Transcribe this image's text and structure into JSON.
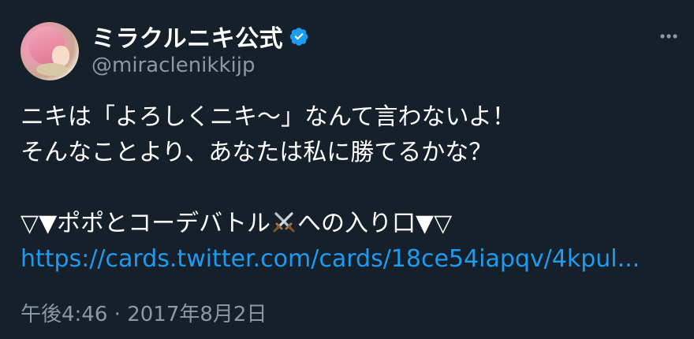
{
  "user": {
    "display_name": "ミラクルニキ公式",
    "handle": "@miraclenikkijp",
    "verified": true
  },
  "tweet": {
    "line1": "ニキは「よろしくニキ〜」なんて言わないよ！",
    "line2": "そんなことより、あなたは私に勝てるかな？",
    "line4_before": "▽▼ポポとコーデバトル",
    "line4_icon": "crossed-swords-emoji",
    "line4_after": "への入り口▼▽",
    "link": "https://cards.twitter.com/cards/18ce54iapqv/4kpul...",
    "time": "午後4:46",
    "separator": "·",
    "date": "2017年8月2日"
  },
  "icons": {
    "verified": "verified-badge-icon",
    "more": "more-options-icon"
  },
  "colors": {
    "background": "#15202b",
    "text": "#ffffff",
    "secondary": "#8b98a5",
    "link": "#1d9bf0",
    "verified": "#1d9bf0"
  }
}
